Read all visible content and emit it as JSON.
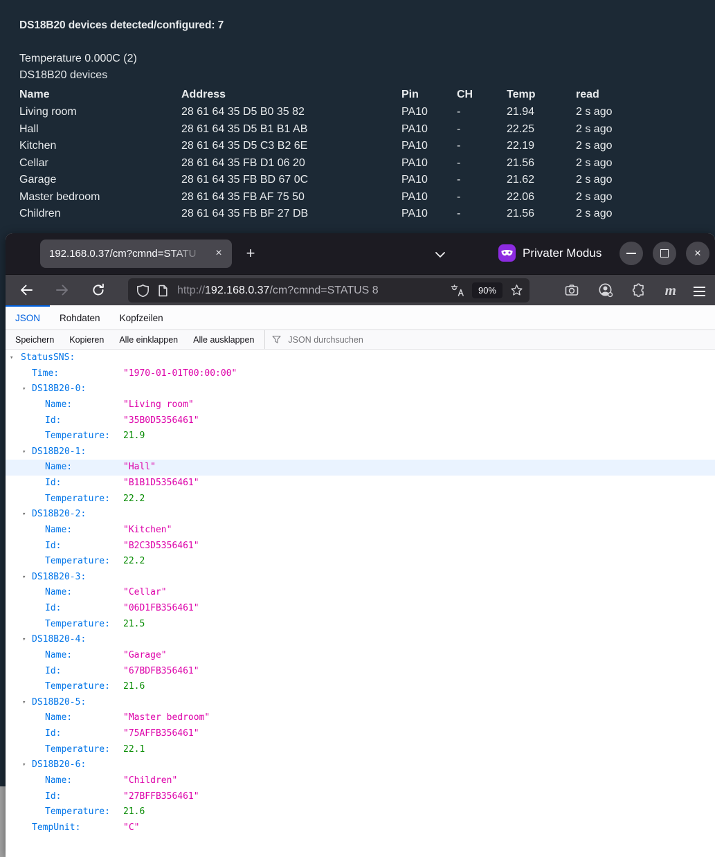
{
  "console": {
    "title": "DS18B20 devices detected/configured: 7",
    "line1": "Temperature 0.000C (2)",
    "line2": "DS18B20 devices",
    "columns": [
      "Name",
      "Address",
      "Pin",
      "CH",
      "Temp",
      "read"
    ],
    "rows": [
      [
        "Living room",
        "28 61 64 35 D5 B0 35 82",
        "PA10",
        "-",
        "21.94",
        "2 s ago"
      ],
      [
        "Hall",
        "28 61 64 35 D5 B1 B1 AB",
        "PA10",
        "-",
        "22.25",
        "2 s ago"
      ],
      [
        "Kitchen",
        "28 61 64 35 D5 C3 B2 6E",
        "PA10",
        "-",
        "22.19",
        "2 s ago"
      ],
      [
        "Cellar",
        "28 61 64 35 FB D1 06 20",
        "PA10",
        "-",
        "21.56",
        "2 s ago"
      ],
      [
        "Garage",
        "28 61 64 35 FB BD 67 0C",
        "PA10",
        "-",
        "21.62",
        "2 s ago"
      ],
      [
        "Master bedroom",
        "28 61 64 35 FB AF 75 50",
        "PA10",
        "-",
        "22.06",
        "2 s ago"
      ],
      [
        "Children",
        "28 61 64 35 FB BF 27 DB",
        "PA10",
        "-",
        "21.56",
        "2 s ago"
      ]
    ]
  },
  "browser": {
    "tab_title": "192.168.0.37/cm?cmnd=STATU",
    "tab_close": "×",
    "new_tab": "+",
    "private_label": "Privater Modus",
    "window_close": "×",
    "url": {
      "scheme": "http://",
      "host": "192.168.0.37",
      "path": "/cm?cmnd=STATUS 8"
    },
    "zoom_level": "90%"
  },
  "viewer": {
    "tabs": [
      {
        "label": "JSON"
      },
      {
        "label": "Rohdaten"
      },
      {
        "label": "Kopfzeilen"
      }
    ],
    "toolbar": {
      "save": "Speichern",
      "copy": "Kopieren",
      "collapse_all": "Alle einklappen",
      "expand_all": "Alle ausklappen",
      "search_placeholder": "JSON durchsuchen"
    }
  },
  "json_rows": [
    {
      "k": "StatusSNS:",
      "lvl": 0,
      "tw": true
    },
    {
      "k": "Time:",
      "lvl": 1,
      "v": "1970-01-01T00:00:00",
      "t": "str"
    },
    {
      "k": "DS18B20-0:",
      "lvl": 1,
      "tw": true
    },
    {
      "k": "Name:",
      "lvl": 2,
      "v": "Living room",
      "t": "str"
    },
    {
      "k": "Id:",
      "lvl": 2,
      "v": "35B0D5356461",
      "t": "str"
    },
    {
      "k": "Temperature:",
      "lvl": 2,
      "v": "21.9",
      "t": "num"
    },
    {
      "k": "DS18B20-1:",
      "lvl": 1,
      "tw": true
    },
    {
      "k": "Name:",
      "lvl": 2,
      "v": "Hall",
      "t": "str",
      "hl": true
    },
    {
      "k": "Id:",
      "lvl": 2,
      "v": "B1B1D5356461",
      "t": "str"
    },
    {
      "k": "Temperature:",
      "lvl": 2,
      "v": "22.2",
      "t": "num"
    },
    {
      "k": "DS18B20-2:",
      "lvl": 1,
      "tw": true
    },
    {
      "k": "Name:",
      "lvl": 2,
      "v": "Kitchen",
      "t": "str"
    },
    {
      "k": "Id:",
      "lvl": 2,
      "v": "B2C3D5356461",
      "t": "str"
    },
    {
      "k": "Temperature:",
      "lvl": 2,
      "v": "22.2",
      "t": "num"
    },
    {
      "k": "DS18B20-3:",
      "lvl": 1,
      "tw": true
    },
    {
      "k": "Name:",
      "lvl": 2,
      "v": "Cellar",
      "t": "str"
    },
    {
      "k": "Id:",
      "lvl": 2,
      "v": "06D1FB356461",
      "t": "str"
    },
    {
      "k": "Temperature:",
      "lvl": 2,
      "v": "21.5",
      "t": "num"
    },
    {
      "k": "DS18B20-4:",
      "lvl": 1,
      "tw": true
    },
    {
      "k": "Name:",
      "lvl": 2,
      "v": "Garage",
      "t": "str"
    },
    {
      "k": "Id:",
      "lvl": 2,
      "v": "67BDFB356461",
      "t": "str"
    },
    {
      "k": "Temperature:",
      "lvl": 2,
      "v": "21.6",
      "t": "num"
    },
    {
      "k": "DS18B20-5:",
      "lvl": 1,
      "tw": true
    },
    {
      "k": "Name:",
      "lvl": 2,
      "v": "Master bedroom",
      "t": "str"
    },
    {
      "k": "Id:",
      "lvl": 2,
      "v": "75AFFB356461",
      "t": "str"
    },
    {
      "k": "Temperature:",
      "lvl": 2,
      "v": "22.1",
      "t": "num"
    },
    {
      "k": "DS18B20-6:",
      "lvl": 1,
      "tw": true
    },
    {
      "k": "Name:",
      "lvl": 2,
      "v": "Children",
      "t": "str"
    },
    {
      "k": "Id:",
      "lvl": 2,
      "v": "27BFFB356461",
      "t": "str"
    },
    {
      "k": "Temperature:",
      "lvl": 2,
      "v": "21.6",
      "t": "num"
    },
    {
      "k": "TempUnit:",
      "lvl": 1,
      "v": "C",
      "t": "str"
    }
  ],
  "colors": {
    "console_bg": "#1c2935",
    "tabbar_bg": "#1c1b22",
    "active_tab_bg": "#48474e",
    "navbar_bg": "#403f45",
    "urlfield_bg": "#29282d",
    "private_purple": "#8c2be0",
    "viewer_accent": "#0061e0",
    "json_key": "#0074e8",
    "json_string": "#dd00a9",
    "json_number": "#058b00",
    "row_highlight": "#eaf3ff"
  }
}
